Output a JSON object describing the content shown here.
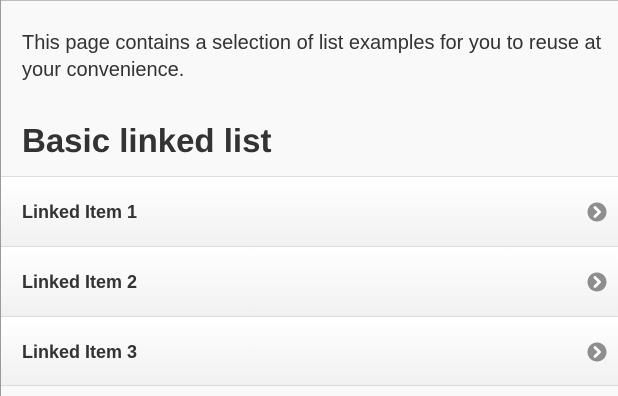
{
  "page": {
    "intro_text": "This page contains a selection of list examples for you to reuse at your convenience.",
    "heading": "Basic linked list"
  },
  "list": {
    "items": [
      {
        "label": "Linked Item 1",
        "icon": "chevron-right-icon"
      },
      {
        "label": "Linked Item 2",
        "icon": "chevron-right-icon"
      },
      {
        "label": "Linked Item 3",
        "icon": "chevron-right-icon"
      }
    ]
  },
  "colors": {
    "text": "#333333",
    "page_background": "#f9f9f9",
    "chevron": "#8e8e8e",
    "divider": "#dcdcdc"
  }
}
